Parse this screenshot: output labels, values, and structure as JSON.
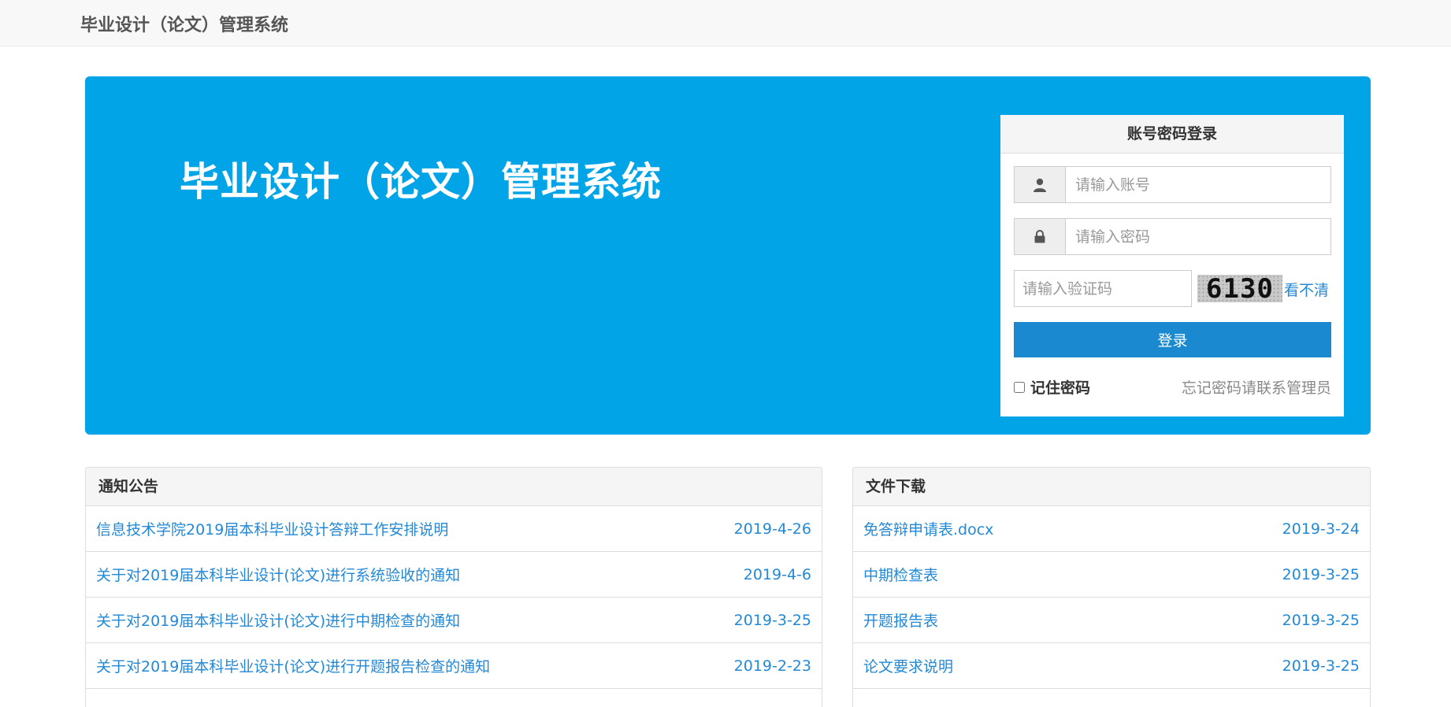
{
  "navbar": {
    "brand": "毕业设计（论文）管理系统"
  },
  "hero": {
    "title": "毕业设计（论文）管理系统"
  },
  "login": {
    "heading": "账号密码登录",
    "username_placeholder": "请输入账号",
    "password_placeholder": "请输入密码",
    "captcha_placeholder": "请输入验证码",
    "captcha_text": "6130",
    "refresh_label": "看不清",
    "submit_label": "登录",
    "remember_label": "记住密码",
    "forgot_text": "忘记密码请联系管理员",
    "icons": {
      "user": "user-icon",
      "lock": "lock-icon"
    }
  },
  "notices": {
    "title": "通知公告",
    "items": [
      {
        "title": "信息技术学院2019届本科毕业设计答辩工作安排说明",
        "date": "2019-4-26"
      },
      {
        "title": "关于对2019届本科毕业设计(论文)进行系统验收的通知",
        "date": "2019-4-6"
      },
      {
        "title": "关于对2019届本科毕业设计(论文)进行中期检查的通知",
        "date": "2019-3-25"
      },
      {
        "title": "关于对2019届本科毕业设计(论文)进行开题报告检查的通知",
        "date": "2019-2-23"
      }
    ]
  },
  "downloads": {
    "title": "文件下载",
    "items": [
      {
        "title": "免答辩申请表.docx",
        "date": "2019-3-24"
      },
      {
        "title": "中期检查表",
        "date": "2019-3-25"
      },
      {
        "title": "开题报告表",
        "date": "2019-3-25"
      },
      {
        "title": "论文要求说明",
        "date": "2019-3-25"
      }
    ]
  },
  "colors": {
    "hero_bg": "#02a4e8",
    "button_bg": "#1a89cf",
    "link": "#2389d6"
  }
}
